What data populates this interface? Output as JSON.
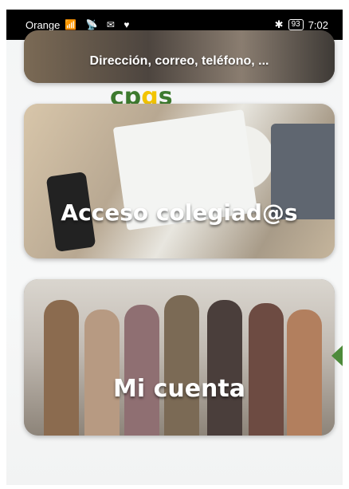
{
  "status_bar": {
    "carrier": "Orange",
    "battery": "93",
    "time": "7:02"
  },
  "cards": {
    "contact_label": "Dirección, correo, teléfono, ...",
    "access_label": "Acceso colegiad@s",
    "account_label": "Mi cuenta"
  },
  "icons": {
    "arrow": "left-arrow-icon"
  },
  "colors": {
    "accent_green": "#4d8a3a"
  }
}
